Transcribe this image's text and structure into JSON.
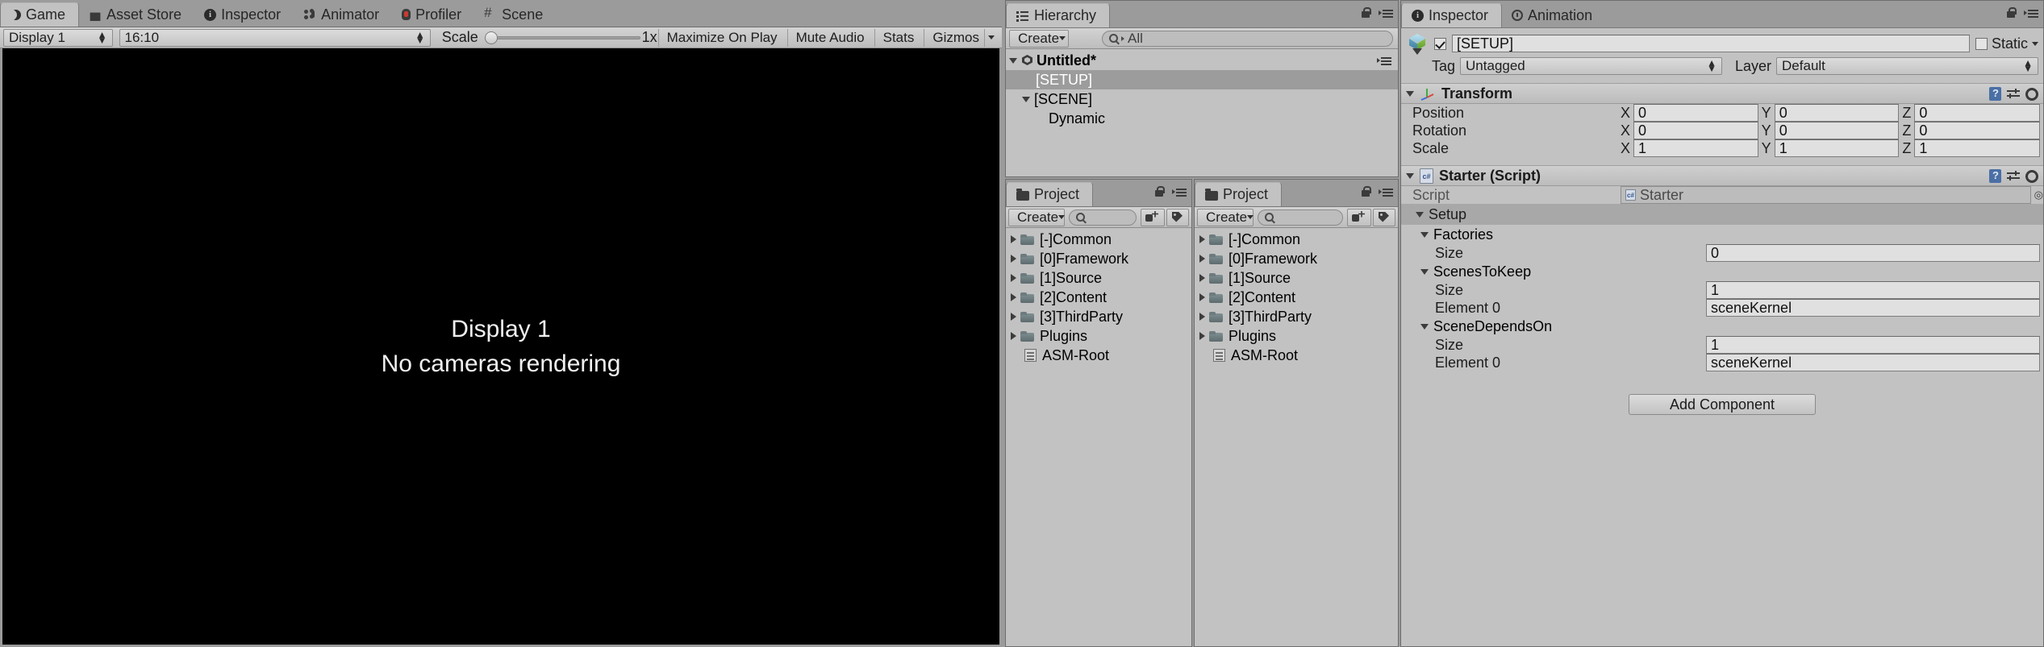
{
  "game_panel": {
    "tabs": [
      {
        "label": "Game",
        "icon": "moon-icon",
        "active": true
      },
      {
        "label": "Asset Store",
        "icon": "store-icon",
        "active": false
      },
      {
        "label": "Inspector",
        "icon": "info-icon",
        "active": false
      },
      {
        "label": "Animator",
        "icon": "animator-icon",
        "active": false
      },
      {
        "label": "Profiler",
        "icon": "profiler-icon",
        "active": false
      },
      {
        "label": "Scene",
        "icon": "grid-icon",
        "active": false
      }
    ],
    "toolbar": {
      "display": "Display 1",
      "aspect": "16:10",
      "scale_label": "Scale",
      "scale_value": "1x",
      "maximize_on_play": "Maximize On Play",
      "mute_audio": "Mute Audio",
      "stats": "Stats",
      "gizmos": "Gizmos"
    },
    "canvas": {
      "line1": "Display 1",
      "line2": "No cameras rendering"
    }
  },
  "hierarchy": {
    "tab_label": "Hierarchy",
    "create_label": "Create",
    "search_placeholder": "All",
    "items": [
      {
        "label": "Untitled*",
        "depth": 0,
        "type": "scene",
        "expanded": true,
        "selected": false
      },
      {
        "label": "[SETUP]",
        "depth": 1,
        "type": "object",
        "expanded": false,
        "selected": true
      },
      {
        "label": "[SCENE]",
        "depth": 1,
        "type": "object",
        "expanded": true,
        "selected": false
      },
      {
        "label": "Dynamic",
        "depth": 2,
        "type": "object",
        "expanded": false,
        "selected": false
      }
    ]
  },
  "project_left": {
    "tab_label": "Project",
    "create_label": "Create",
    "search_placeholder": "",
    "items": [
      {
        "label": "[-]Common",
        "type": "folder"
      },
      {
        "label": "[0]Framework",
        "type": "folder"
      },
      {
        "label": "[1]Source",
        "type": "folder"
      },
      {
        "label": "[2]Content",
        "type": "folder"
      },
      {
        "label": "[3]ThirdParty",
        "type": "folder"
      },
      {
        "label": "Plugins",
        "type": "folder"
      },
      {
        "label": "ASM-Root",
        "type": "file"
      }
    ]
  },
  "project_right": {
    "tab_label": "Project",
    "create_label": "Create",
    "search_placeholder": "",
    "items": [
      {
        "label": "[-]Common",
        "type": "folder"
      },
      {
        "label": "[0]Framework",
        "type": "folder"
      },
      {
        "label": "[1]Source",
        "type": "folder"
      },
      {
        "label": "[2]Content",
        "type": "folder"
      },
      {
        "label": "[3]ThirdParty",
        "type": "folder"
      },
      {
        "label": "Plugins",
        "type": "folder"
      },
      {
        "label": "ASM-Root",
        "type": "file"
      }
    ]
  },
  "inspector": {
    "tabs": [
      {
        "label": "Inspector",
        "icon": "info-icon",
        "active": true
      },
      {
        "label": "Animation",
        "icon": "clock-icon",
        "active": false
      }
    ],
    "object_name": "[SETUP]",
    "object_enabled": true,
    "static_label": "Static",
    "static_checked": false,
    "tag_label": "Tag",
    "tag_value": "Untagged",
    "layer_label": "Layer",
    "layer_value": "Default",
    "transform": {
      "title": "Transform",
      "rows": [
        {
          "label": "Position",
          "x": "0",
          "y": "0",
          "z": "0"
        },
        {
          "label": "Rotation",
          "x": "0",
          "y": "0",
          "z": "0"
        },
        {
          "label": "Scale",
          "x": "1",
          "y": "1",
          "z": "1"
        }
      ],
      "axis_labels": [
        "X",
        "Y",
        "Z"
      ]
    },
    "starter": {
      "title": "Starter (Script)",
      "script_label": "Script",
      "script_value": "Starter",
      "setup_label": "Setup",
      "groups": [
        {
          "name": "Factories",
          "rows": [
            {
              "label": "Size",
              "value": "0"
            }
          ]
        },
        {
          "name": "ScenesToKeep",
          "rows": [
            {
              "label": "Size",
              "value": "1"
            },
            {
              "label": "Element 0",
              "value": "sceneKernel"
            }
          ]
        },
        {
          "name": "SceneDependsOn",
          "rows": [
            {
              "label": "Size",
              "value": "1"
            },
            {
              "label": "Element 0",
              "value": "sceneKernel"
            }
          ]
        }
      ]
    },
    "add_component_label": "Add Component"
  }
}
